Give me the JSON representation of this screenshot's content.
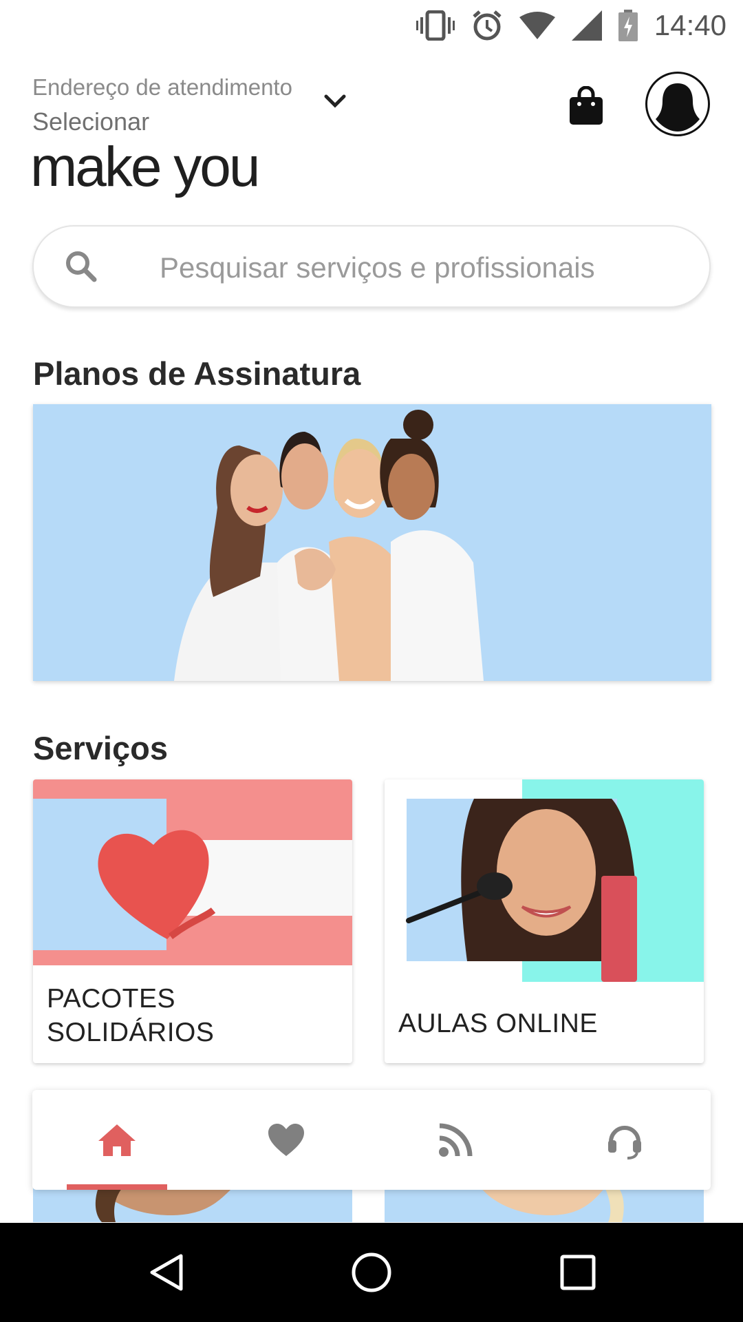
{
  "status_bar": {
    "time": "14:40"
  },
  "header": {
    "address_label": "Endereço de atendimento",
    "address_value": "Selecionar",
    "logo_text": "make you"
  },
  "search": {
    "placeholder": "Pesquisar serviços e profissionais"
  },
  "sections": {
    "plans_title": "Planos de Assinatura",
    "services_title": "Serviços"
  },
  "services": [
    {
      "label_line1": "PACOTES",
      "label_line2": "SOLIDÁRIOS"
    },
    {
      "label_line1": "AULAS ONLINE"
    }
  ],
  "bottom_nav": {
    "active": "home",
    "items": [
      "home-icon",
      "heart-icon",
      "feed-icon",
      "support-icon"
    ]
  },
  "colors": {
    "accent": "#e0605f",
    "banner_bg": "#b6daf8",
    "coral": "#f48f8d",
    "mint": "#88f4ea",
    "inactive_icon": "#808080"
  }
}
